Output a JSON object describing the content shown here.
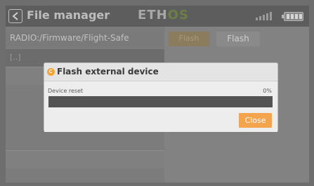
{
  "header": {
    "title": "File manager",
    "logo_main": "ETH",
    "logo_accent": "OS"
  },
  "file_browser": {
    "path": "RADIO:/Firmware/Flight-Safe",
    "items": [
      {
        "name": "[..]",
        "selected": true
      },
      {
        "name": "",
        "selected": false
      },
      {
        "name": "",
        "selected": false
      },
      {
        "name": "",
        "selected": false
      },
      {
        "name": "",
        "selected": false
      }
    ]
  },
  "right_pane": {
    "primary_button_label": "Flash",
    "secondary_button_label": "Flash"
  },
  "dialog": {
    "title": "Flash external device",
    "progress_label": "Device reset",
    "progress_percent_text": "0%",
    "progress_value": 0,
    "close_label": "Close"
  },
  "colors": {
    "accent": "#f3a44c",
    "dialog_bg": "#ededed",
    "progress_track": "#535353"
  },
  "icons": [
    "back-arrow-icon",
    "signal-icon",
    "battery-icon",
    "info-icon"
  ]
}
